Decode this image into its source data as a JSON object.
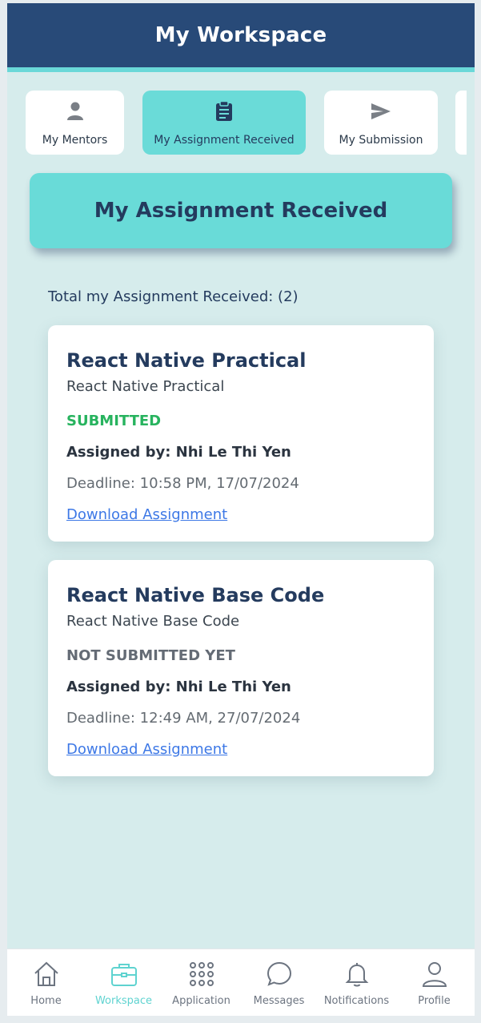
{
  "app": {
    "title": "My Workspace"
  },
  "tabs": [
    {
      "label": "My Mentors",
      "icon": "person-icon",
      "active": false
    },
    {
      "label": "My Assignment Received",
      "icon": "clipboard-icon",
      "active": true
    },
    {
      "label": "My Submission",
      "icon": "send-icon",
      "active": false
    }
  ],
  "section": {
    "title": "My Assignment Received",
    "total_text": "Total my Assignment Received: (2)"
  },
  "assignments": [
    {
      "title": "React Native Practical",
      "subtitle": "React Native Practical",
      "status": "SUBMITTED",
      "status_color": "#27b35e",
      "assigned_by": "Assigned by: Nhi Le Thi Yen",
      "deadline": "Deadline: 10:58 PM, 17/07/2024",
      "link": "Download Assignment"
    },
    {
      "title": "React Native Base Code",
      "subtitle": "React Native Base Code",
      "status": "NOT SUBMITTED YET",
      "status_color": "#646b75",
      "assigned_by": "Assigned by: Nhi Le Thi Yen",
      "deadline": "Deadline: 12:49 AM, 27/07/2024",
      "link": "Download Assignment"
    }
  ],
  "nav": [
    {
      "label": "Home",
      "icon": "home-icon",
      "active": false
    },
    {
      "label": "Workspace",
      "icon": "briefcase-icon",
      "active": true
    },
    {
      "label": "Application",
      "icon": "grid-icon",
      "active": false
    },
    {
      "label": "Messages",
      "icon": "chat-icon",
      "active": false
    },
    {
      "label": "Notifications",
      "icon": "bell-icon",
      "active": false
    },
    {
      "label": "Profile",
      "icon": "user-icon",
      "active": false
    }
  ],
  "colors": {
    "header": "#284a78",
    "accent": "#6adbd8",
    "background": "#d6ecec",
    "link": "#3d78e6"
  }
}
